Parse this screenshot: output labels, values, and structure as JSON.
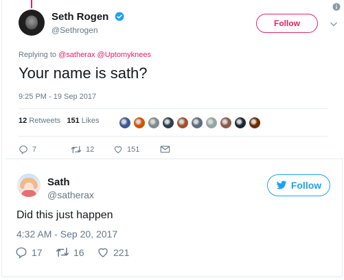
{
  "quoted_tweet": {
    "author_name": "Seth Rogen",
    "author_handle": "@Sethrogen",
    "follow_label": "Follow",
    "replying_prefix": "Replying to",
    "replying_to": [
      "@satherax",
      "@Uptomyknees"
    ],
    "text": "Your name is sath?",
    "timestamp": "9:25 PM - 19 Sep 2017",
    "retweets_count": "12",
    "retweets_label": "Retweets",
    "likes_count": "151",
    "likes_label": "Likes",
    "likers": [
      {
        "color": "#3b5998"
      },
      {
        "color": "#d35400"
      },
      {
        "color": "#7f8c8d"
      },
      {
        "color": "#2c3e50"
      },
      {
        "color": "#a0522d"
      },
      {
        "color": "#5d6d7e"
      },
      {
        "color": "#95a5a6"
      },
      {
        "color": "#8e5a4b"
      },
      {
        "color": "#1c2833"
      },
      {
        "color": "#6e2c00"
      }
    ],
    "actions": {
      "replies": "7",
      "retweets": "12",
      "likes": "151"
    }
  },
  "tweet": {
    "author_name": "Sath",
    "author_handle": "@satherax",
    "follow_label": "Follow",
    "text": "Did this just happen",
    "timestamp": "4:32 AM - Sep 20, 2017",
    "actions": {
      "replies": "17",
      "retweets": "16",
      "likes": "221"
    }
  },
  "colors": {
    "twitter_blue": "#1da1f2",
    "accent_red": "#e0245e",
    "muted_text": "#657786",
    "primary_text": "#14171a"
  },
  "icons": [
    "verified-badge-icon",
    "info-icon",
    "chevron-down-icon",
    "reply-icon",
    "retweet-icon",
    "like-heart-icon",
    "message-icon",
    "twitter-bird-icon"
  ]
}
